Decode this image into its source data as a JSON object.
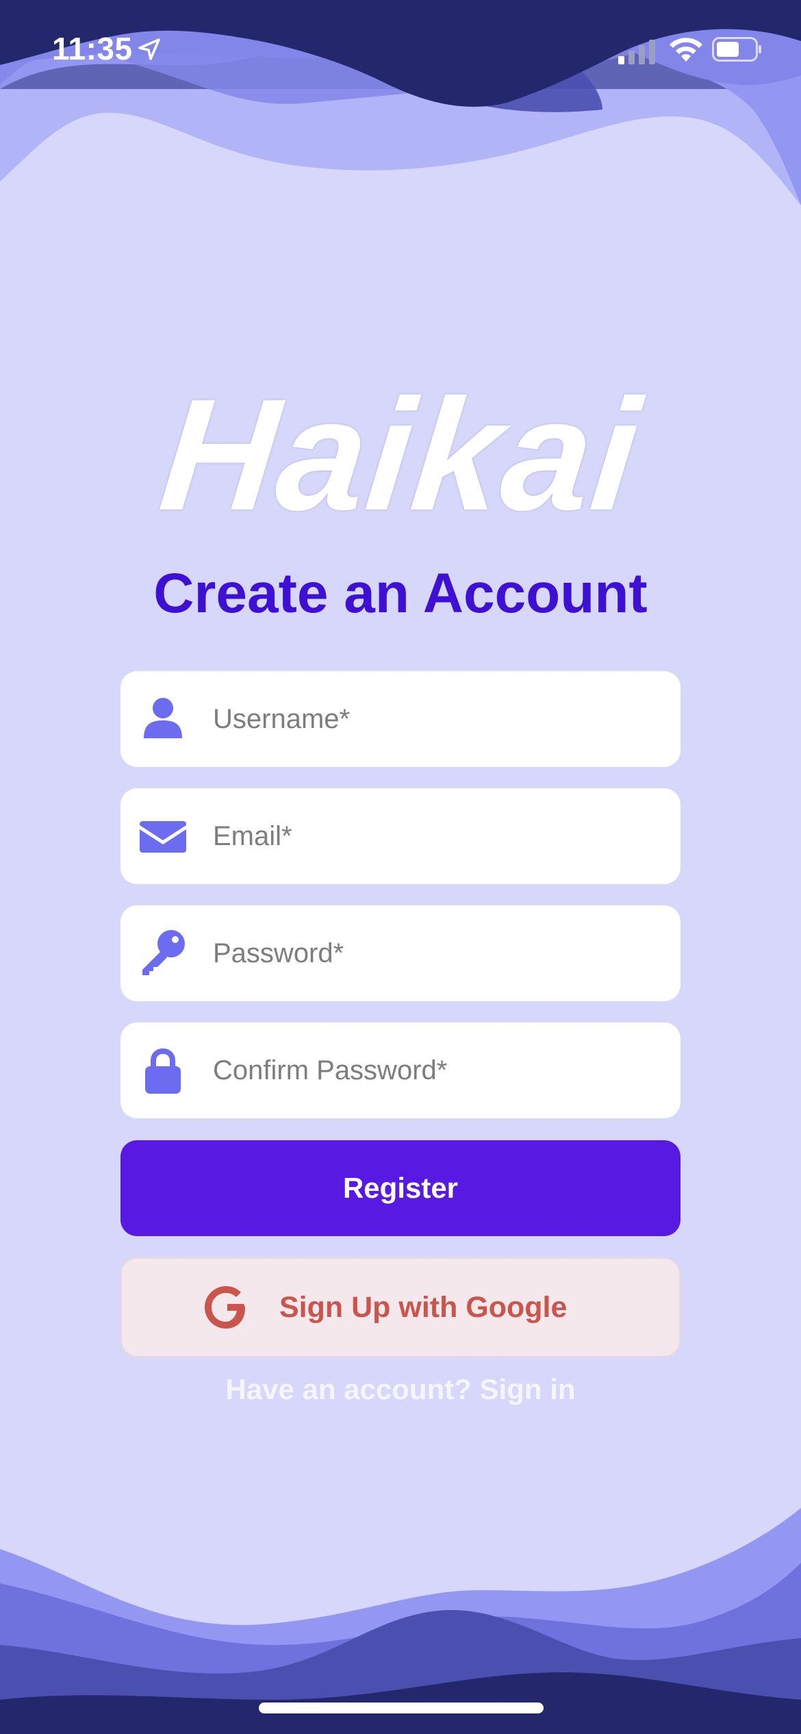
{
  "status_bar": {
    "time": "11:35",
    "icons": [
      "location-arrow-icon",
      "cellular-signal-icon",
      "wifi-icon",
      "battery-icon"
    ]
  },
  "logo": {
    "text": "Haikai"
  },
  "title": "Create an Account",
  "form": {
    "username": {
      "value": "",
      "placeholder": "Username*",
      "icon": "person-icon"
    },
    "email": {
      "value": "",
      "placeholder": "Email*",
      "icon": "envelope-icon"
    },
    "password": {
      "value": "",
      "placeholder": "Password*",
      "icon": "key-icon"
    },
    "confirm_password": {
      "value": "",
      "placeholder": "Confirm Password*",
      "icon": "lock-icon"
    }
  },
  "buttons": {
    "register_label": "Register",
    "google_label": "Sign Up with Google",
    "google_icon": "google-g-icon"
  },
  "signin_link": "Have an account? Sign in",
  "colors": {
    "background": "#d6d7fb",
    "title": "#3d10d4",
    "icon": "#6b6cf0",
    "register_button": "#5819e3",
    "google_button_bg": "#f4e8ec",
    "google_text": "#c9554d",
    "wave_dark": "#23276b",
    "wave_mid": "#4a4fb0",
    "wave_light": "#6f72dc",
    "wave_lighter": "#9497f2"
  }
}
